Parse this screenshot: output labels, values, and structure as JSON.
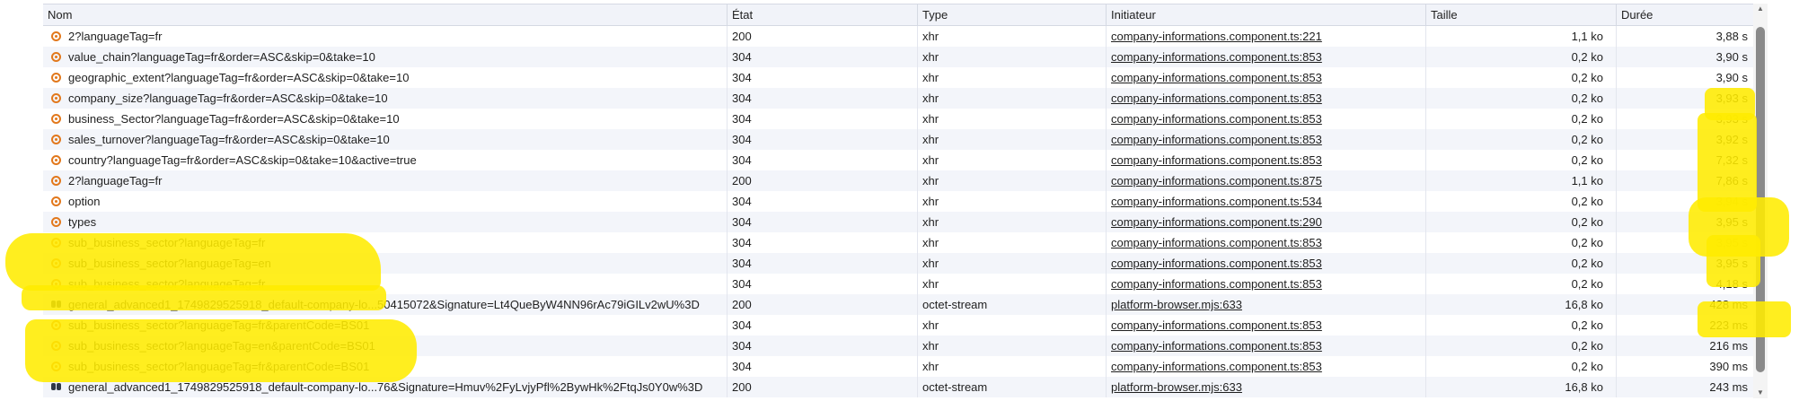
{
  "columns": {
    "name": "Nom",
    "status": "État",
    "type": "Type",
    "initiator": "Initiateur",
    "size": "Taille",
    "duration": "Durée"
  },
  "rows": [
    {
      "icon": "xhr-icon",
      "name": "2?languageTag=fr",
      "status": "200",
      "type": "xhr",
      "initiator": "company-informations.component.ts:221",
      "size": "1,1 ko",
      "duration": "3,88 s"
    },
    {
      "icon": "xhr-icon",
      "name": "value_chain?languageTag=fr&order=ASC&skip=0&take=10",
      "status": "304",
      "type": "xhr",
      "initiator": "company-informations.component.ts:853",
      "size": "0,2 ko",
      "duration": "3,90 s"
    },
    {
      "icon": "xhr-icon",
      "name": "geographic_extent?languageTag=fr&order=ASC&skip=0&take=10",
      "status": "304",
      "type": "xhr",
      "initiator": "company-informations.component.ts:853",
      "size": "0,2 ko",
      "duration": "3,90 s"
    },
    {
      "icon": "xhr-icon",
      "name": "company_size?languageTag=fr&order=ASC&skip=0&take=10",
      "status": "304",
      "type": "xhr",
      "initiator": "company-informations.component.ts:853",
      "size": "0,2 ko",
      "duration": "3,93 s"
    },
    {
      "icon": "xhr-icon",
      "name": "business_Sector?languageTag=fr&order=ASC&skip=0&take=10",
      "status": "304",
      "type": "xhr",
      "initiator": "company-informations.component.ts:853",
      "size": "0,2 ko",
      "duration": "3,93 s"
    },
    {
      "icon": "xhr-icon",
      "name": "sales_turnover?languageTag=fr&order=ASC&skip=0&take=10",
      "status": "304",
      "type": "xhr",
      "initiator": "company-informations.component.ts:853",
      "size": "0,2 ko",
      "duration": "3,92 s"
    },
    {
      "icon": "xhr-icon",
      "name": "country?languageTag=fr&order=ASC&skip=0&take=10&active=true",
      "status": "304",
      "type": "xhr",
      "initiator": "company-informations.component.ts:853",
      "size": "0,2 ko",
      "duration": "7,32 s"
    },
    {
      "icon": "xhr-icon",
      "name": "2?languageTag=fr",
      "status": "200",
      "type": "xhr",
      "initiator": "company-informations.component.ts:875",
      "size": "1,1 ko",
      "duration": "7,86 s"
    },
    {
      "icon": "xhr-icon",
      "name": "option",
      "status": "304",
      "type": "xhr",
      "initiator": "company-informations.component.ts:534",
      "size": "0,2 ko",
      "duration": "3,94 s"
    },
    {
      "icon": "xhr-icon",
      "name": "types",
      "status": "304",
      "type": "xhr",
      "initiator": "company-informations.component.ts:290",
      "size": "0,2 ko",
      "duration": "3,95 s"
    },
    {
      "icon": "xhr-icon",
      "name": "sub_business_sector?languageTag=fr",
      "status": "304",
      "type": "xhr",
      "initiator": "company-informations.component.ts:853",
      "size": "0,2 ko",
      "duration": "3,95 s"
    },
    {
      "icon": "xhr-icon",
      "name": "sub_business_sector?languageTag=en",
      "status": "304",
      "type": "xhr",
      "initiator": "company-informations.component.ts:853",
      "size": "0,2 ko",
      "duration": "3,95 s"
    },
    {
      "icon": "xhr-icon",
      "name": "sub_business_sector?languageTag=fr",
      "status": "304",
      "type": "xhr",
      "initiator": "company-informations.component.ts:853",
      "size": "0,2 ko",
      "duration": "4,18 s"
    },
    {
      "icon": "octet-stream-icon",
      "name": "general_advanced1_1749829525918_default-company-lo...50415072&Signature=Lt4QueByW4NN96rAc79iGILv2wU%3D",
      "status": "200",
      "type": "octet-stream",
      "initiator": "platform-browser.mjs:633",
      "size": "16,8 ko",
      "duration": "428 ms"
    },
    {
      "icon": "xhr-icon",
      "name": "sub_business_sector?languageTag=fr&parentCode=BS01",
      "status": "304",
      "type": "xhr",
      "initiator": "company-informations.component.ts:853",
      "size": "0,2 ko",
      "duration": "223 ms"
    },
    {
      "icon": "xhr-icon",
      "name": "sub_business_sector?languageTag=en&parentCode=BS01",
      "status": "304",
      "type": "xhr",
      "initiator": "company-informations.component.ts:853",
      "size": "0,2 ko",
      "duration": "216 ms"
    },
    {
      "icon": "xhr-icon",
      "name": "sub_business_sector?languageTag=fr&parentCode=BS01",
      "status": "304",
      "type": "xhr",
      "initiator": "company-informations.component.ts:853",
      "size": "0,2 ko",
      "duration": "390 ms"
    },
    {
      "icon": "octet-stream-icon",
      "name": "general_advanced1_1749829525918_default-company-lo...76&Signature=Hmuv%2FyLvjyPfl%2BywHk%2FtqJs0Y0w%3D",
      "status": "200",
      "type": "octet-stream",
      "initiator": "platform-browser.mjs:633",
      "size": "16,8 ko",
      "duration": "243 ms"
    }
  ],
  "colors": {
    "header_bg": "#f1f3f9",
    "stripe_bg": "#f3f5fa",
    "xhr_icon": "#e2781c",
    "highlight": "#ffec00"
  }
}
